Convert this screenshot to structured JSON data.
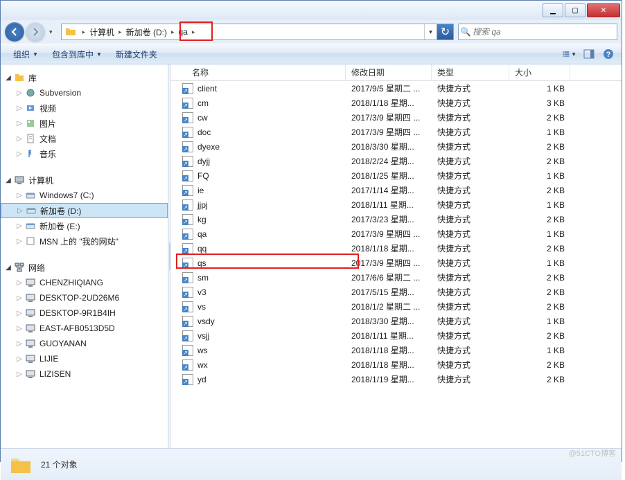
{
  "window_controls": {
    "min": "▁",
    "max": "▢",
    "close": "✕"
  },
  "breadcrumbs": [
    "计算机",
    "新加卷 (D:)",
    "qa"
  ],
  "address_dropdown": "▾",
  "refresh_icon": "↻",
  "search": {
    "placeholder": "搜索 qa",
    "icon": "🔍"
  },
  "toolbar": {
    "organize": "组织",
    "include": "包含到库中",
    "newfolder": "新建文件夹"
  },
  "columns": {
    "name": "名称",
    "date": "修改日期",
    "type": "类型",
    "size": "大小"
  },
  "sidebar": {
    "libraries": {
      "root": "库",
      "items": [
        "Subversion",
        "视频",
        "图片",
        "文档",
        "音乐"
      ]
    },
    "computer": {
      "root": "计算机",
      "items": [
        "Windows7 (C:)",
        "新加卷 (D:)",
        "新加卷 (E:)",
        "MSN 上的 \"我的网站\""
      ],
      "selected_index": 1
    },
    "network": {
      "root": "网络",
      "items": [
        "CHENZHIQIANG",
        "DESKTOP-2UD26M6",
        "DESKTOP-9R1B4IH",
        "EAST-AFB0513D5D",
        "GUOYANAN",
        "LIJIE",
        "LIZISEN"
      ]
    }
  },
  "files": [
    {
      "name": "client",
      "date": "2017/9/5 星期二 ...",
      "type": "快捷方式",
      "size": "1 KB"
    },
    {
      "name": "cm",
      "date": "2018/1/18 星期...",
      "type": "快捷方式",
      "size": "3 KB"
    },
    {
      "name": "cw",
      "date": "2017/3/9 星期四 ...",
      "type": "快捷方式",
      "size": "2 KB"
    },
    {
      "name": "doc",
      "date": "2017/3/9 星期四 ...",
      "type": "快捷方式",
      "size": "1 KB"
    },
    {
      "name": "dyexe",
      "date": "2018/3/30 星期...",
      "type": "快捷方式",
      "size": "2 KB"
    },
    {
      "name": "dyjj",
      "date": "2018/2/24 星期...",
      "type": "快捷方式",
      "size": "2 KB"
    },
    {
      "name": "FQ",
      "date": "2018/1/25 星期...",
      "type": "快捷方式",
      "size": "1 KB"
    },
    {
      "name": "ie",
      "date": "2017/1/14 星期...",
      "type": "快捷方式",
      "size": "2 KB"
    },
    {
      "name": "jjpj",
      "date": "2018/1/11 星期...",
      "type": "快捷方式",
      "size": "1 KB"
    },
    {
      "name": "kg",
      "date": "2017/3/23 星期...",
      "type": "快捷方式",
      "size": "2 KB"
    },
    {
      "name": "qa",
      "date": "2017/3/9 星期四 ...",
      "type": "快捷方式",
      "size": "1 KB"
    },
    {
      "name": "qq",
      "date": "2018/1/18 星期...",
      "type": "快捷方式",
      "size": "2 KB"
    },
    {
      "name": "qs",
      "date": "2017/3/9 星期四 ...",
      "type": "快捷方式",
      "size": "1 KB"
    },
    {
      "name": "sm",
      "date": "2017/6/6 星期二 ...",
      "type": "快捷方式",
      "size": "2 KB"
    },
    {
      "name": "v3",
      "date": "2017/5/15 星期...",
      "type": "快捷方式",
      "size": "2 KB"
    },
    {
      "name": "vs",
      "date": "2018/1/2 星期二 ...",
      "type": "快捷方式",
      "size": "2 KB"
    },
    {
      "name": "vsdy",
      "date": "2018/3/30 星期...",
      "type": "快捷方式",
      "size": "1 KB"
    },
    {
      "name": "vsjj",
      "date": "2018/1/11 星期...",
      "type": "快捷方式",
      "size": "2 KB"
    },
    {
      "name": "ws",
      "date": "2018/1/18 星期...",
      "type": "快捷方式",
      "size": "1 KB"
    },
    {
      "name": "wx",
      "date": "2018/1/18 星期...",
      "type": "快捷方式",
      "size": "2 KB"
    },
    {
      "name": "yd",
      "date": "2018/1/19 星期...",
      "type": "快捷方式",
      "size": "2 KB"
    }
  ],
  "status": "21 个对象",
  "watermark": "@51CTO博客"
}
